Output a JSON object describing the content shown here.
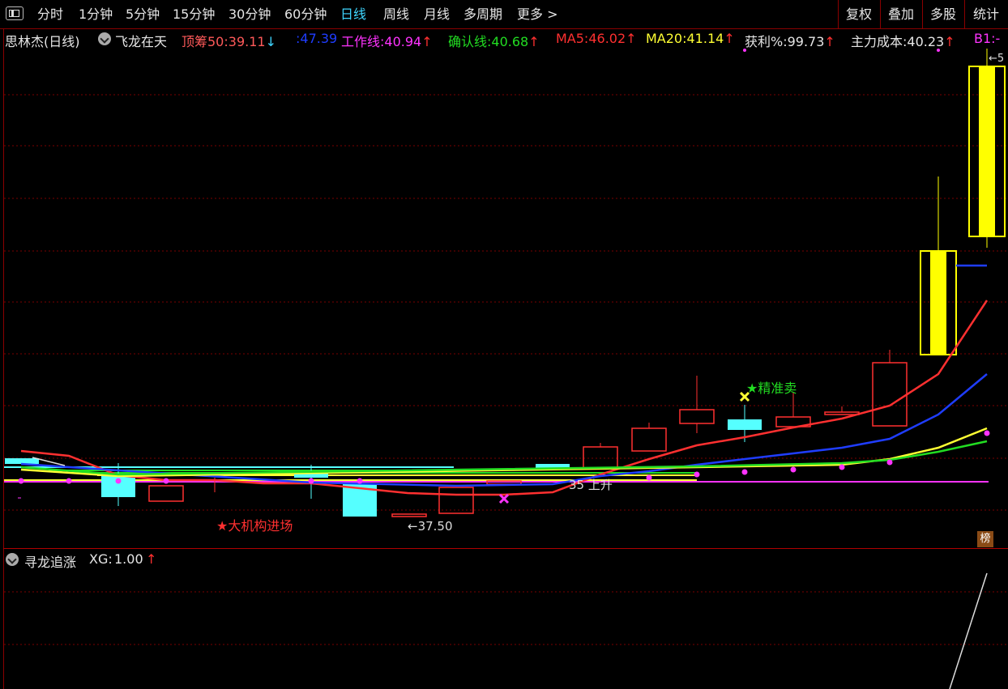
{
  "toolbar": {
    "periods": [
      "分时",
      "1分钟",
      "5分钟",
      "15分钟",
      "30分钟",
      "60分钟",
      "日线",
      "周线",
      "月线",
      "多周期",
      "更多 >"
    ],
    "active_period": "日线",
    "right_buttons": [
      "复权",
      "叠加",
      "多股",
      "统计"
    ]
  },
  "header": {
    "stock_name": "思林杰(日线)",
    "indicator_name": "飞龙在天",
    "items": [
      {
        "label": "顶筹50:",
        "value": "39.11",
        "arrow": "↓",
        "color": "#ff5a5a",
        "arrow_color": "#3fd6ff"
      },
      {
        "label": ":",
        "value": "47.39",
        "arrow": "",
        "color": "#1f3dff",
        "arrow_color": "#1f3dff"
      },
      {
        "label": "工作线:",
        "value": "40.94",
        "arrow": "↑",
        "color": "#ff33ff",
        "arrow_color": "#ff3030"
      },
      {
        "label": "确认线:",
        "value": "40.68",
        "arrow": "↑",
        "color": "#22dd22",
        "arrow_color": "#ff3030"
      },
      {
        "label": "MA5:",
        "value": "46.02",
        "arrow": "↑",
        "color": "#ff3030",
        "arrow_color": "#ff3030"
      },
      {
        "label": "MA20:",
        "value": "41.14",
        "arrow": "↑",
        "color": "#ffff33",
        "arrow_color": "#ff3030"
      },
      {
        "label": "获利%:",
        "value": "99.73",
        "arrow": "↑",
        "color": "#e6e6e6",
        "arrow_color": "#ff3030"
      },
      {
        "label": "主力成本:",
        "value": "40.23",
        "arrow": "↑",
        "color": "#e6e6e6",
        "arrow_color": "#ff3030"
      },
      {
        "label": "B1:",
        "value": "-",
        "arrow": "",
        "color": "#ff33ff",
        "arrow_color": "#ff33ff"
      }
    ]
  },
  "annotations": {
    "big_institution": "★大机构进场",
    "precise_sell": "★精准卖",
    "low_price": "←37.50",
    "rise_label": "35 上升",
    "high_label": "←5"
  },
  "sub_panel": {
    "name": "寻龙追涨",
    "xg_label": "XG:",
    "xg_value": "1.00",
    "xg_arrow": "↑"
  },
  "rank_badge": "榜",
  "colors": {
    "up": "#ff3030",
    "down": "#55ffff",
    "limit_up": "#ffff00",
    "grid": "#8a0000"
  }
}
